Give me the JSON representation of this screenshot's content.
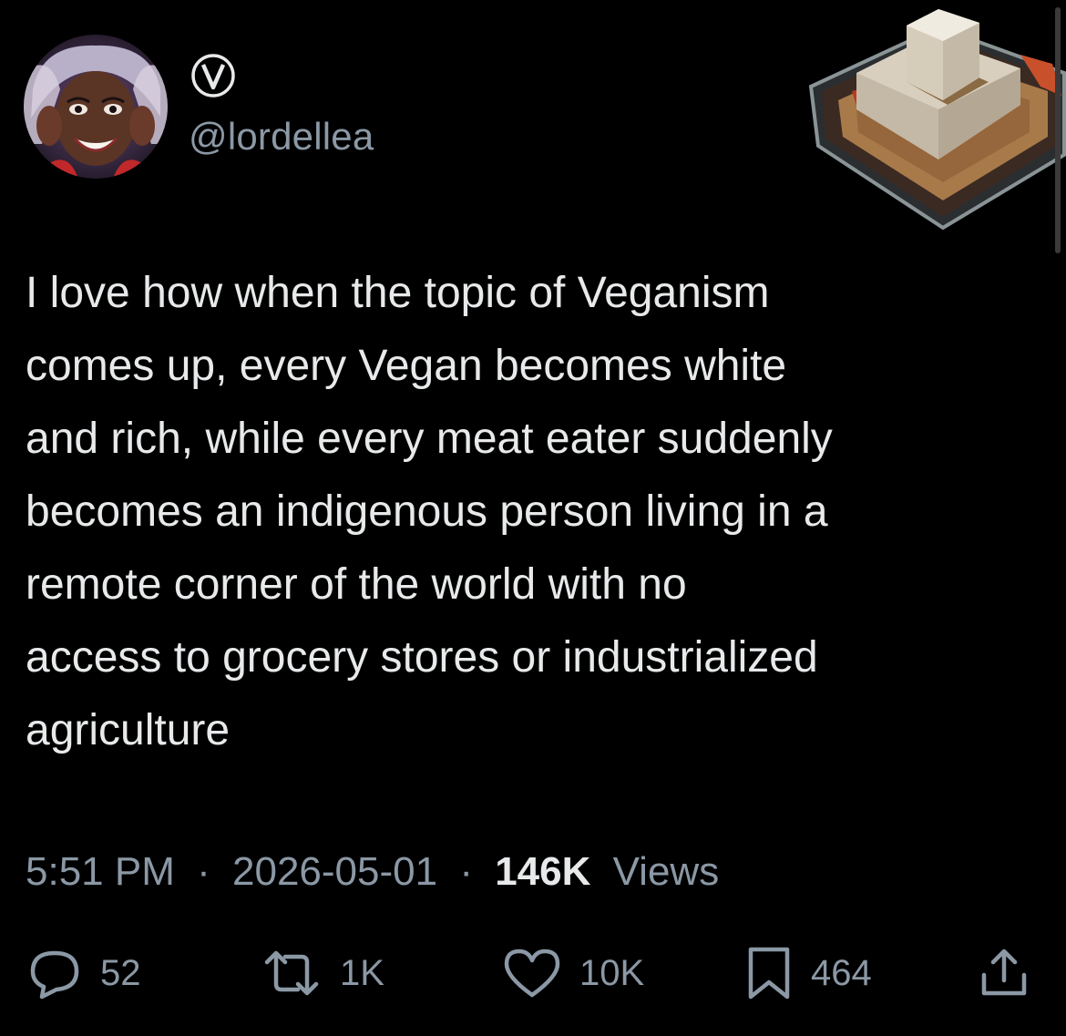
{
  "author": {
    "handle": "@lordellea",
    "badge_icon": "verified-v-icon",
    "avatar_icon": "profile-avatar"
  },
  "tweet": {
    "text_lines": [
      "I love how when the topic of Veganism",
      "comes up, every Vegan becomes white",
      "and rich, while every meat eater suddenly",
      "becomes an indigenous person living in a",
      "remote corner of the world with no",
      "access to grocery stores or industrialized",
      "agriculture"
    ]
  },
  "meta": {
    "time": "5:51 PM",
    "separator": "·",
    "date": "2026-05-01",
    "views_count": "146K",
    "views_label": "Views"
  },
  "actions": {
    "replies": "52",
    "retweets": "1K",
    "likes": "10K",
    "bookmarks": "464"
  },
  "colors": {
    "background": "#000000",
    "primary_text": "#e7e9ea",
    "secondary_text": "#8b98a5"
  }
}
